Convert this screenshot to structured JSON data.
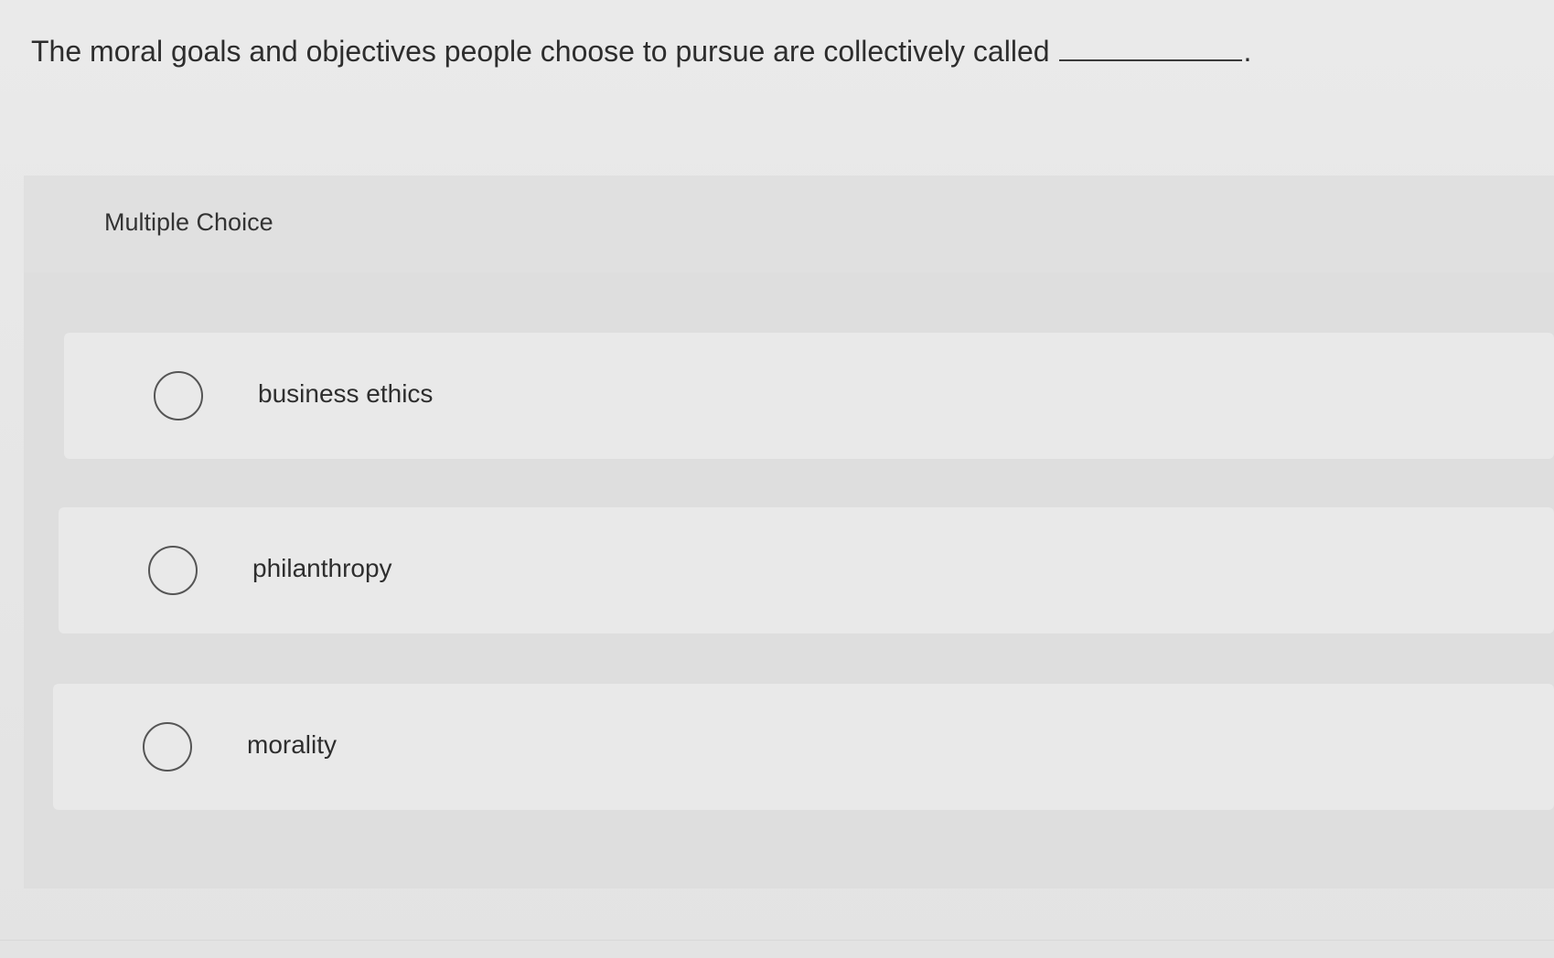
{
  "question": {
    "text": "The moral goals and objectives people choose to pursue are collectively called",
    "blank_suffix": "."
  },
  "section": {
    "label": "Multiple Choice"
  },
  "options": [
    {
      "label": "business ethics",
      "selected": false
    },
    {
      "label": "philanthropy",
      "selected": false
    },
    {
      "label": "morality",
      "selected": false
    }
  ]
}
